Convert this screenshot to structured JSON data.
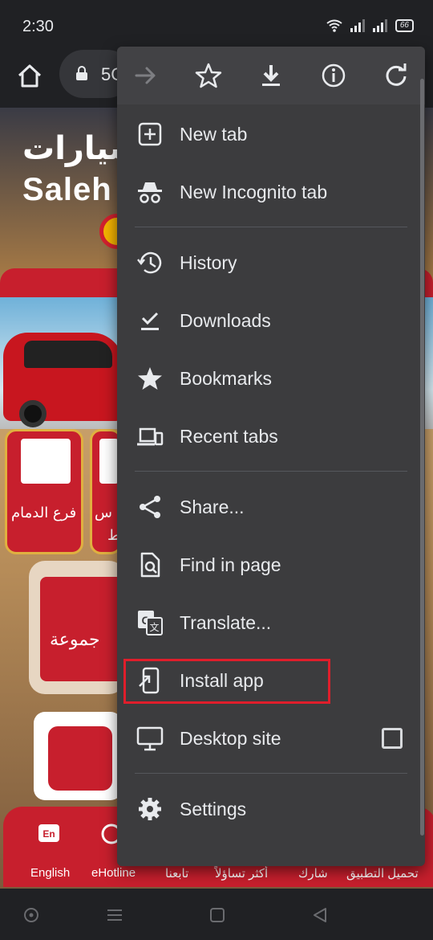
{
  "status": {
    "time": "2:30",
    "battery": "66"
  },
  "browser": {
    "url_partial": "5C"
  },
  "site": {
    "logo_ar": "السيارات",
    "logo_en": "Saleh",
    "tile1_label": "فرع الدمام",
    "tile2_label": "س",
    "tile2_label_line2": "ط",
    "frame_label": "جموعة",
    "bottom_items": [
      {
        "label": "English",
        "icon": "En"
      },
      {
        "label": "eHotline"
      },
      {
        "label": "تابعنا"
      },
      {
        "label": "شارك"
      },
      {
        "label": "أكثر تساؤلاً"
      },
      {
        "label": "تحميل التطبيق"
      }
    ]
  },
  "menu": {
    "top_icons": [
      "forward-icon",
      "star-icon",
      "download-icon",
      "info-icon",
      "reload-icon"
    ],
    "items": [
      {
        "label": "New tab",
        "icon": "new-tab-icon"
      },
      {
        "label": "New Incognito tab",
        "icon": "incognito-icon"
      },
      {
        "label": "History",
        "icon": "history-icon"
      },
      {
        "label": "Downloads",
        "icon": "downloads-icon"
      },
      {
        "label": "Bookmarks",
        "icon": "bookmarks-star-icon"
      },
      {
        "label": "Recent tabs",
        "icon": "devices-icon"
      },
      {
        "label": "Share...",
        "icon": "share-icon"
      },
      {
        "label": "Find in page",
        "icon": "find-in-page-icon"
      },
      {
        "label": "Translate...",
        "icon": "translate-icon"
      },
      {
        "label": "Install app",
        "icon": "install-app-icon"
      },
      {
        "label": "Desktop site",
        "icon": "desktop-icon"
      },
      {
        "label": "Settings",
        "icon": "settings-gear-icon"
      }
    ],
    "desktop_site_checked": false,
    "highlight_color": "#e01e2b"
  },
  "colors": {
    "menu_bg": "#3c3c3e",
    "brand_red": "#c71f2d",
    "accent_gold": "#e0b040"
  }
}
